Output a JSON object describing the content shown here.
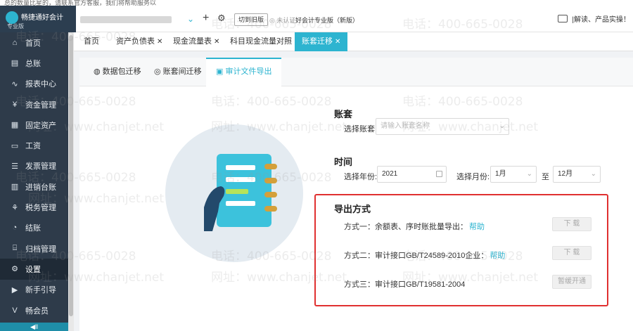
{
  "notice": "总的数量比星的，请联系官方客服，我们将帮助服务以",
  "header": {
    "logo_title": "畅捷通好会计",
    "logo_sub": "专业版",
    "switch_label": "切到旧版",
    "cert_label": "未认证",
    "edition_label": "好会计专业版（新版）",
    "right_text": "|解读、产品实操！"
  },
  "sidebar": {
    "items": [
      {
        "label": "首页",
        "icon": "⌂"
      },
      {
        "label": "总账",
        "icon": "▤"
      },
      {
        "label": "报表中心",
        "icon": "∿"
      },
      {
        "label": "资金管理",
        "icon": "¥"
      },
      {
        "label": "固定资产",
        "icon": "▦"
      },
      {
        "label": "工资",
        "icon": "▭"
      },
      {
        "label": "发票管理",
        "icon": "☰"
      },
      {
        "label": "进销台账",
        "icon": "▥"
      },
      {
        "label": "税务管理",
        "icon": "⚘"
      },
      {
        "label": "结账",
        "icon": "◔"
      },
      {
        "label": "归档管理",
        "icon": "⌸"
      },
      {
        "label": "设置",
        "icon": "⚙"
      },
      {
        "label": "新手引导",
        "icon": "▶"
      },
      {
        "label": "畅会员",
        "icon": "V"
      }
    ],
    "active_index": 11,
    "footer": "◀ll"
  },
  "tabs": [
    {
      "label": "首页",
      "closable": false
    },
    {
      "label": "资产负债表",
      "closable": true
    },
    {
      "label": "现金流量表",
      "closable": true
    },
    {
      "label": "科目现金流量对照",
      "closable": true
    },
    {
      "label": "账套迁移",
      "closable": true
    }
  ],
  "subtabs": [
    {
      "label": "数据包迁移",
      "icon": "◍"
    },
    {
      "label": "账套间迁移",
      "icon": "◎"
    },
    {
      "label": "审计文件导出",
      "icon": "▣"
    }
  ],
  "form": {
    "account_section": "账套",
    "account_label": "选择账套:",
    "account_placeholder": "请输入账套名称",
    "time_section": "时间",
    "year_label": "选择年份:",
    "year_value": "2021",
    "month_label": "选择月份:",
    "month_from": "1月",
    "to_label": "至",
    "month_to": "12月"
  },
  "export": {
    "section": "导出方式",
    "help": "帮助",
    "methods": [
      {
        "label": "方式一：余额表、序时账批量导出：",
        "has_help": true,
        "button": "下 载"
      },
      {
        "label": "方式二：审计接口GB/T24589-2010企业：",
        "has_help": true,
        "button": "下 载"
      },
      {
        "label": "方式三：审计接口GB/T19581-2004",
        "has_help": false,
        "button": "暂缓开通"
      }
    ]
  },
  "watermark": {
    "phone": "电话：400-665-0028",
    "url": "网址：www.chanjet.net"
  },
  "colors": {
    "accent": "#2db4d0",
    "sidebar": "#2e3b4a",
    "highlight": "#e03030"
  }
}
